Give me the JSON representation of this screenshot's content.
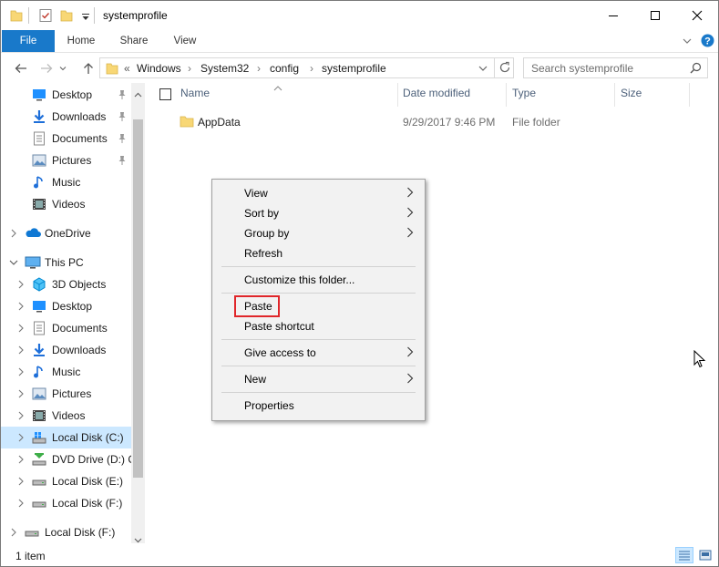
{
  "title": "systemprofile",
  "ribbon": {
    "tabs": [
      "File",
      "Home",
      "Share",
      "View"
    ]
  },
  "address": {
    "prefix": "«",
    "crumbs": [
      "Windows",
      "System32",
      "config",
      "systemprofile"
    ]
  },
  "search": {
    "placeholder": "Search systemprofile"
  },
  "nav": {
    "quick_access": [
      {
        "label": "Desktop",
        "icon": "desktop-icon",
        "pinned": true
      },
      {
        "label": "Downloads",
        "icon": "downloads-icon",
        "pinned": true
      },
      {
        "label": "Documents",
        "icon": "documents-icon",
        "pinned": true
      },
      {
        "label": "Pictures",
        "icon": "pictures-icon",
        "pinned": true
      },
      {
        "label": "Music",
        "icon": "music-icon",
        "pinned": false
      },
      {
        "label": "Videos",
        "icon": "videos-icon",
        "pinned": false
      }
    ],
    "onedrive": "OneDrive",
    "this_pc": "This PC",
    "pc_items": [
      {
        "label": "3D Objects",
        "icon": "3d-objects-icon"
      },
      {
        "label": "Desktop",
        "icon": "desktop-icon"
      },
      {
        "label": "Documents",
        "icon": "documents-icon"
      },
      {
        "label": "Downloads",
        "icon": "downloads-icon"
      },
      {
        "label": "Music",
        "icon": "music-icon"
      },
      {
        "label": "Pictures",
        "icon": "pictures-icon"
      },
      {
        "label": "Videos",
        "icon": "videos-icon"
      },
      {
        "label": "Local Disk (C:)",
        "icon": "system-drive-icon",
        "selected": true
      },
      {
        "label": "DVD Drive (D:) C",
        "icon": "dvd-drive-icon"
      },
      {
        "label": "Local Disk (E:)",
        "icon": "drive-icon"
      },
      {
        "label": "Local Disk (F:)",
        "icon": "drive-icon"
      }
    ],
    "network_drive": "Local Disk (F:)"
  },
  "columns": {
    "name": "Name",
    "date": "Date modified",
    "type": "Type",
    "size": "Size"
  },
  "files": [
    {
      "name": "AppData",
      "date": "9/29/2017 9:46 PM",
      "type": "File folder",
      "size": ""
    }
  ],
  "context_menu": {
    "items": [
      {
        "label": "View",
        "submenu": true
      },
      {
        "label": "Sort by",
        "submenu": true
      },
      {
        "label": "Group by",
        "submenu": true
      },
      {
        "label": "Refresh",
        "submenu": false
      },
      {
        "label": "Customize this folder...",
        "submenu": false
      },
      {
        "label": "Paste",
        "submenu": false,
        "highlighted": true
      },
      {
        "label": "Paste shortcut",
        "submenu": false
      },
      {
        "label": "Give access to",
        "submenu": true
      },
      {
        "label": "New",
        "submenu": true
      },
      {
        "label": "Properties",
        "submenu": false
      }
    ]
  },
  "status": {
    "item_count": "1 item"
  },
  "colors": {
    "accent": "#1979ca",
    "selection": "#cce8ff",
    "highlight_box": "#e0262a",
    "folder": "#f8d775"
  }
}
